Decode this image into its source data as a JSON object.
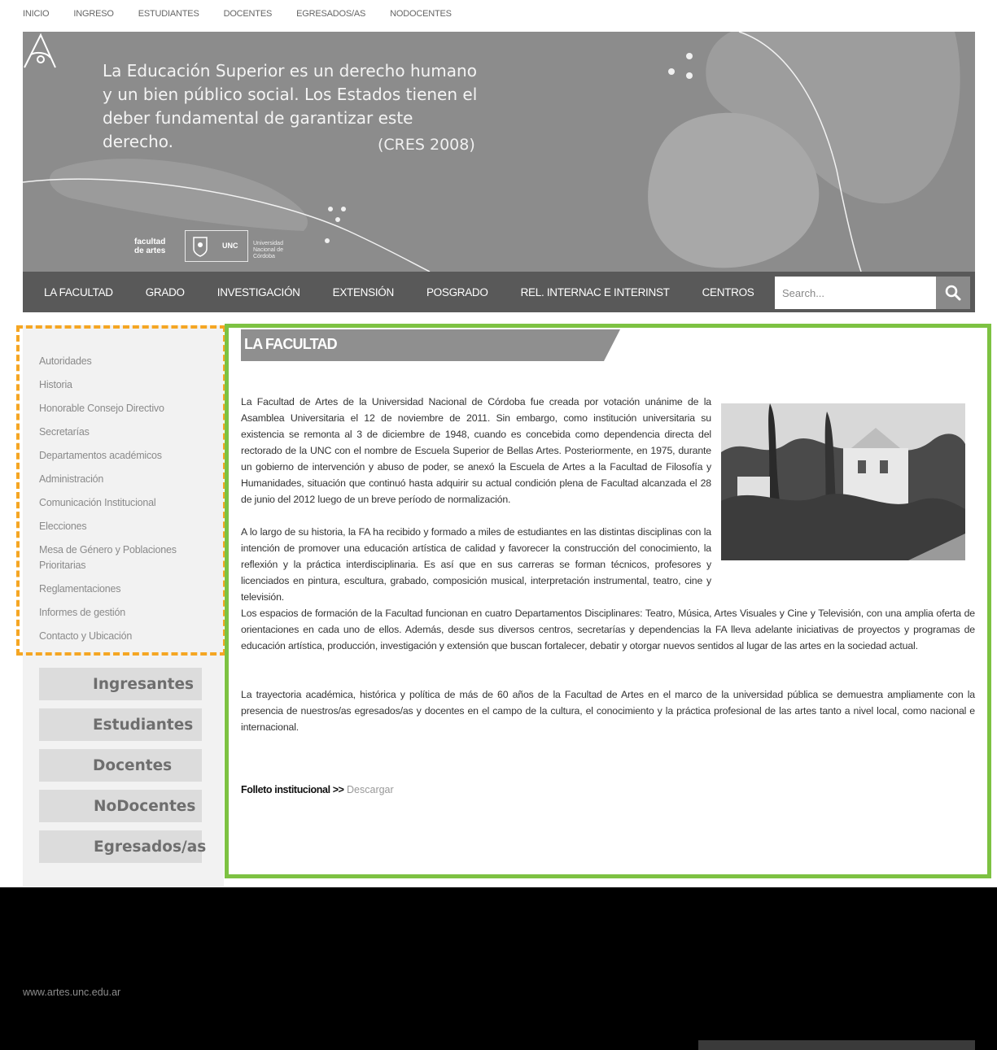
{
  "top_nav": [
    "INICIO",
    "INGRESO",
    "ESTUDIANTES",
    "DOCENTES",
    "EGRESADOS/AS",
    "NODOCENTES"
  ],
  "banner": {
    "quote": "La Educación Superior es un derecho humano y un bien público social. Los Estados tienen el deber fundamental de garantizar este derecho.",
    "citation": "(CRES 2008)",
    "logo_fa": "facultad de artes",
    "logo_unc": "UNC",
    "logo_unc_sub": "Universidad Nacional de Córdoba"
  },
  "main_nav": [
    "LA FACULTAD",
    "GRADO",
    "INVESTIGACIÓN",
    "EXTENSIÓN",
    "POSGRADO",
    "REL. INTERNAC E INTERINST",
    "CENTROS"
  ],
  "search": {
    "placeholder": "Search...",
    "icon": "search-icon"
  },
  "sidebar": {
    "items": [
      "Autoridades",
      "Historia",
      "Honorable Consejo Directivo",
      "Secretarías",
      "Departamentos académicos",
      "Administración",
      "Comunicación Institucional",
      "Elecciones",
      "Mesa de Género y Poblaciones Prioritarias",
      "Reglamentaciones",
      "Informes de gestión",
      "Contacto y Ubicación"
    ],
    "quick_links": [
      "Ingresantes",
      "Estudiantes",
      "Docentes",
      "NoDocentes",
      "Egresados/as"
    ]
  },
  "content": {
    "title": "LA FACULTAD",
    "paragraphs": [
      "La Facultad de Artes de la Universidad Nacional de Córdoba fue creada por votación unánime de la Asamblea Universitaria el 12 de noviembre de 2011. Sin embargo, como institución universitaria su existencia se remonta al 3 de diciembre de 1948, cuando es concebida como dependencia directa del rectorado de la UNC con el nombre de Escuela Superior de Bellas Artes. Posteriormente, en 1975, durante un gobierno de intervención y abuso de poder, se anexó la Escuela de Artes a la Facultad de Filosofía y Humanidades, situación que continuó hasta adquirir su actual condición plena de Facultad alcanzada el 28 de junio del 2012 luego de un breve período de normalización.",
      "A lo largo de su historia, la FA ha recibido y formado a miles de estudiantes en las distintas disciplinas con la intención de promover una educación artística de calidad y favorecer la construcción del conocimiento, la reflexión y la práctica interdisciplinaria. Es así que en sus carreras se forman técnicos, profesores y licenciados en pintura, escultura, grabado, composición musical, interpretación instrumental, teatro, cine y televisión.",
      "Los espacios de formación de la Facultad funcionan en cuatro Departamentos Disciplinares: Teatro, Música, Artes Visuales y Cine y Televisión, con una amplia oferta de orientaciones en cada uno de ellos. Además, desde sus diversos centros, secretarías y dependencias la FA lleva adelante iniciativas de proyectos y programas de educación artística, producción, investigación y extensión que buscan fortalecer, debatir y otorgar nuevos sentidos al lugar de las artes en la sociedad actual.",
      "La trayectoria académica, histórica y política de más de 60 años de la Facultad de Artes en el marco de la universidad pública se demuestra ampliamente con la presencia de nuestros/as egresados/as y docentes en el campo de la cultura, el conocimiento y la práctica profesional de las artes tanto a nivel local, como nacional e internacional."
    ],
    "folleto_label": "Folleto institucional >>",
    "folleto_link": "Descargar"
  },
  "footer": {
    "url": "www.artes.unc.edu.ar"
  },
  "colors": {
    "nav_bg": "#595959",
    "banner_bg": "#8c8c8c",
    "sidebar_outline": "#f5a623",
    "content_outline": "#7dc242"
  }
}
